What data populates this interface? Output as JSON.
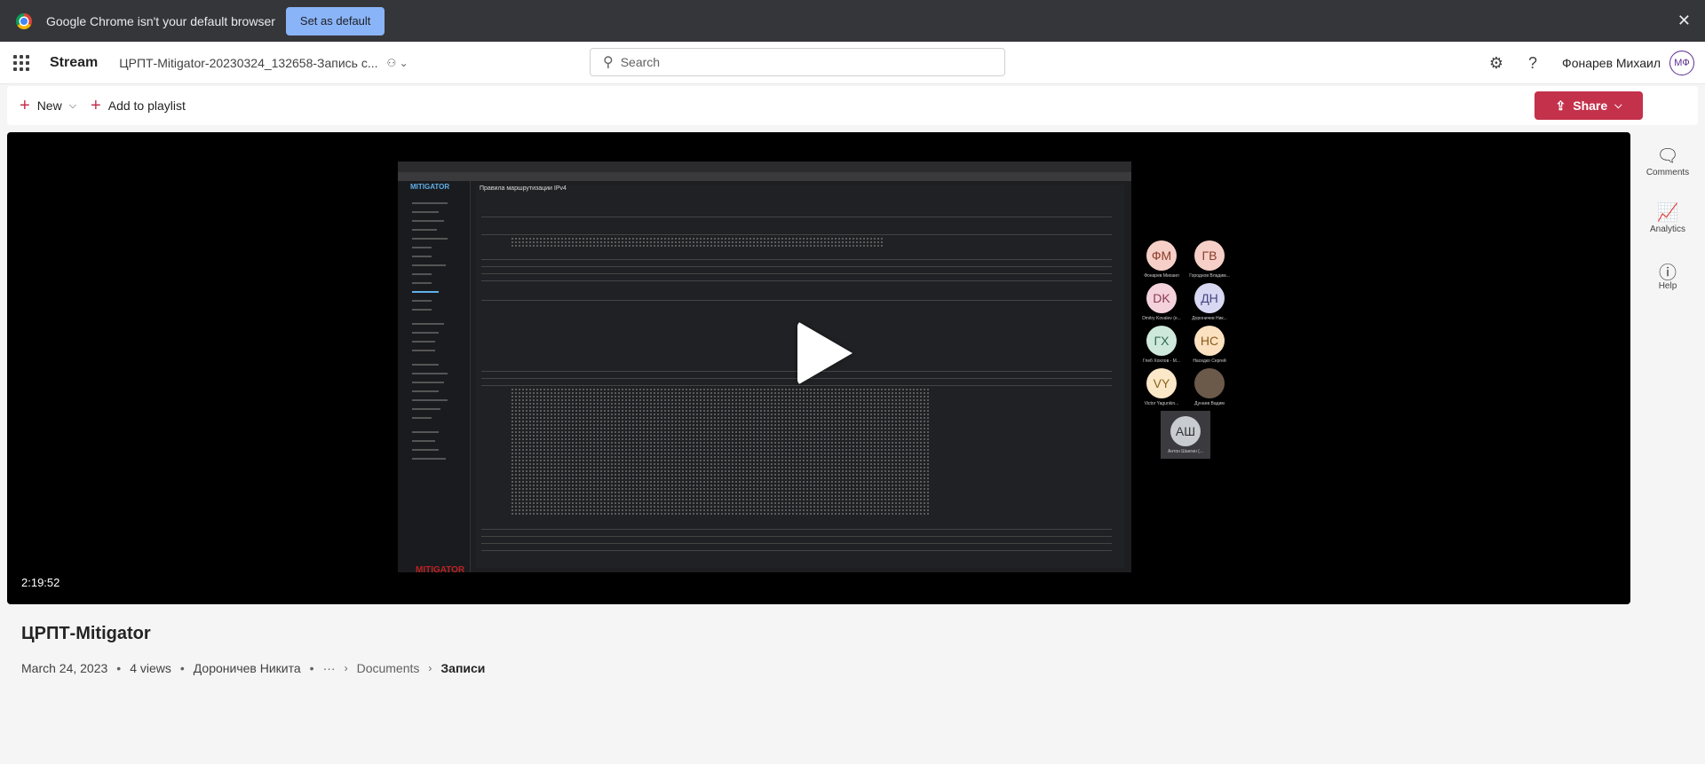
{
  "infobar": {
    "message": "Google Chrome isn't your default browser",
    "button": "Set as default",
    "close_icon": "close-icon"
  },
  "header": {
    "app_name": "Stream",
    "doc_title": "ЦРПТ-Mitigator-20230324_132658-Запись с...",
    "search_placeholder": "Search",
    "user_name": "Фонарев Михаил",
    "user_initials": "МФ"
  },
  "commands": {
    "new_label": "New",
    "add_playlist_label": "Add to playlist",
    "share_label": "Share"
  },
  "video": {
    "duration": "2:19:52",
    "screen_heading": "Правила маршрутизации IPv4",
    "screen_logo": "MITIGATOR",
    "screen_footer_logo": "MITIGATOR",
    "participants": [
      {
        "initials": "ФМ",
        "name": "Фонарев Михаил",
        "color": "#f6d0c8",
        "fg": "#8a3b2a"
      },
      {
        "initials": "ГВ",
        "name": "Городнов Владим...",
        "color": "#f6d0c8",
        "fg": "#8a3b2a"
      },
      {
        "initials": "DK",
        "name": "Dmitry Kovalev (е...",
        "color": "#f4d2dc",
        "fg": "#8b3a56"
      },
      {
        "initials": "ДН",
        "name": "Дороничев Ник...",
        "color": "#d8d8f2",
        "fg": "#454585"
      },
      {
        "initials": "ГХ",
        "name": "Глеб Хохлов - М...",
        "color": "#cfe8dc",
        "fg": "#2e6b4f"
      },
      {
        "initials": "НС",
        "name": "Наседко Сергей",
        "color": "#fbe1c0",
        "fg": "#8a5a18"
      },
      {
        "initials": "VY",
        "name": "Victor Yagunkin...",
        "color": "#fbe8c8",
        "fg": "#8a6418"
      },
      {
        "initials": "",
        "name": "Дунаев Вадим",
        "color": "#6b5a4a",
        "fg": "#fff"
      },
      {
        "initials": "АШ",
        "name": "Антон Шангин (...",
        "color": "#c8cbd0",
        "fg": "#333"
      }
    ]
  },
  "rail": {
    "comments": "Comments",
    "analytics": "Analytics",
    "help": "Help"
  },
  "info": {
    "title": "ЦРПТ-Mitigator",
    "date": "March 24, 2023",
    "views": "4 views",
    "author": "Дороничев Никита",
    "more": "···",
    "crumb1": "Documents",
    "crumb2": "Записи"
  }
}
